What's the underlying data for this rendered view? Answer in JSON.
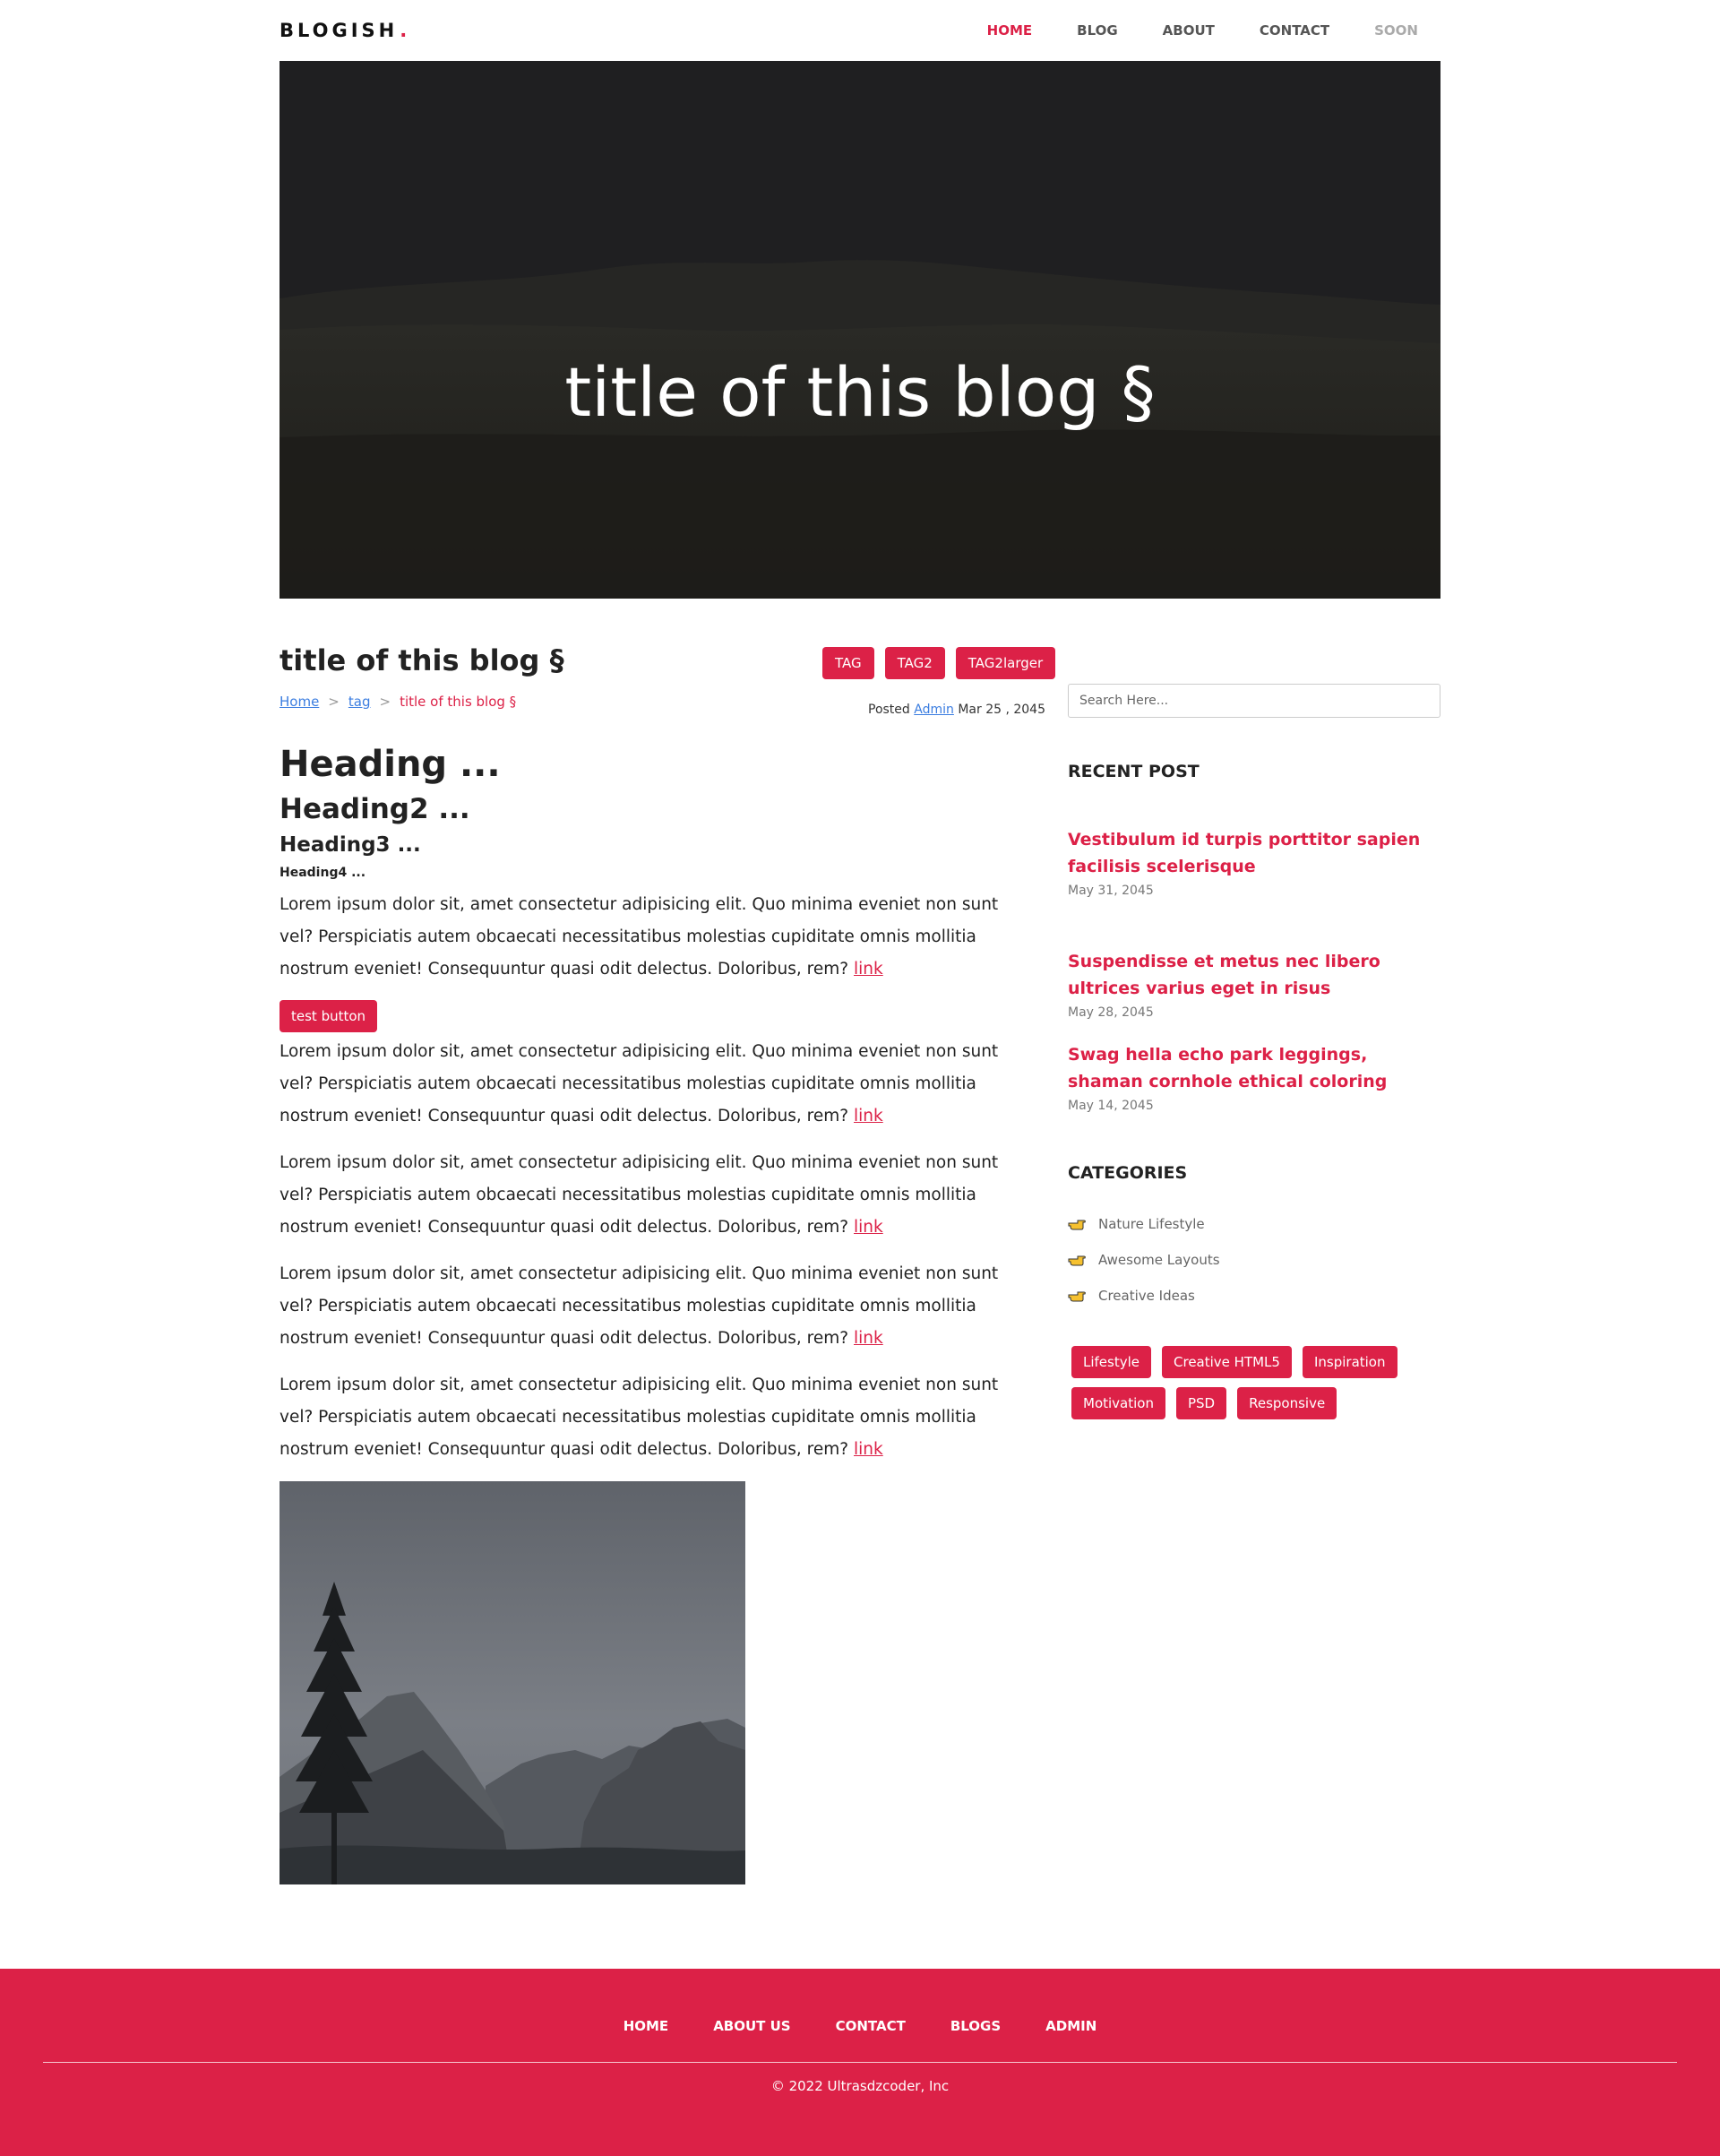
{
  "header": {
    "brand": "BLOGISH",
    "brand_dot": ".",
    "nav": [
      {
        "label": "HOME",
        "state": "active"
      },
      {
        "label": "BLOG",
        "state": "normal"
      },
      {
        "label": "ABOUT",
        "state": "normal"
      },
      {
        "label": "CONTACT",
        "state": "normal"
      },
      {
        "label": "SOON",
        "state": "disabled"
      }
    ]
  },
  "hero": {
    "title": "title of this blog §"
  },
  "post": {
    "title": "title of this blog §",
    "tags": [
      "TAG",
      "TAG2",
      "TAG2larger"
    ],
    "breadcrumb": {
      "home": "Home",
      "sep1": ">",
      "tag": "tag",
      "sep2": ">",
      "current": "title of this blog §"
    },
    "meta": {
      "posted_label": "Posted",
      "author": "Admin",
      "date": "Mar 25 , 2045"
    },
    "h1": "Heading ...",
    "h2": "Heading2 ...",
    "h3": "Heading3 ...",
    "h4": "Heading4 ...",
    "paragraph_text": "Lorem ipsum dolor sit, amet consectetur adipisicing elit. Quo minima eveniet non sunt vel? Perspiciatis autem obcaecati necessitatibus molestias cupiditate omnis mollitia nostrum eveniet! Consequuntur quasi odit delectus. Doloribus, rem?",
    "link_label": "link",
    "test_button": "test button"
  },
  "sidebar": {
    "search_placeholder": "Search Here...",
    "recent_heading": "RECENT POST",
    "recent_posts": [
      {
        "title": "Vestibulum id turpis porttitor sapien facilisis scelerisque",
        "date": "May 31, 2045"
      },
      {
        "title": "Suspendisse et metus nec libero ultrices varius eget in risus",
        "date": "May 28, 2045"
      },
      {
        "title": "Swag hella echo park leggings, shaman cornhole ethical coloring",
        "date": "May 14, 2045"
      }
    ],
    "categories_heading": "CATEGORIES",
    "categories": [
      "Nature Lifestyle",
      "Awesome Layouts",
      "Creative Ideas"
    ],
    "tags": [
      "Lifestyle",
      "Creative HTML5",
      "Inspiration",
      "Motivation",
      "PSD",
      "Responsive"
    ]
  },
  "footer": {
    "nav": [
      "HOME",
      "ABOUT US",
      "CONTACT",
      "BLOGS",
      "ADMIN"
    ],
    "copyright": "© 2022 Ultrasdzcoder, Inc"
  },
  "colors": {
    "accent": "#dc2147",
    "link": "#3b7de0"
  }
}
